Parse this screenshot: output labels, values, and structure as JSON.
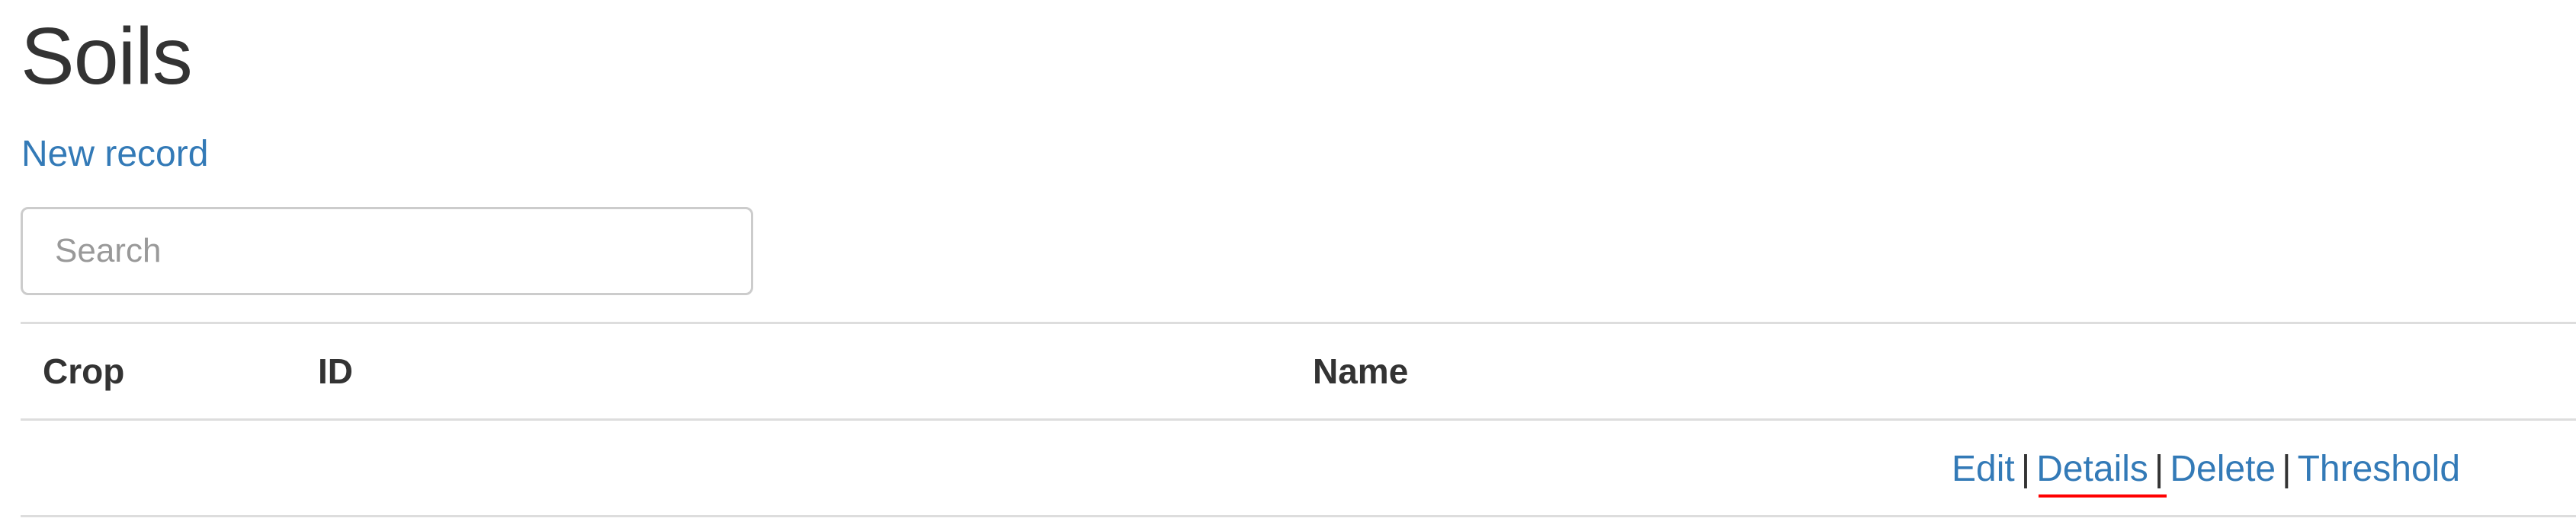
{
  "page": {
    "title": "Soils",
    "new_record_label": "New record"
  },
  "search": {
    "placeholder": "Search",
    "value": ""
  },
  "table": {
    "columns": [
      "Crop",
      "ID",
      "Name"
    ],
    "rows": [
      {
        "crop": "",
        "id": "",
        "name": "",
        "actions": [
          "Edit",
          "Details",
          "Delete",
          "Threshold"
        ],
        "separator": "|"
      }
    ]
  },
  "colors": {
    "link": "#337ab7",
    "text": "#333333",
    "border": "#dddddd",
    "highlight_underline": "#ff0000"
  }
}
